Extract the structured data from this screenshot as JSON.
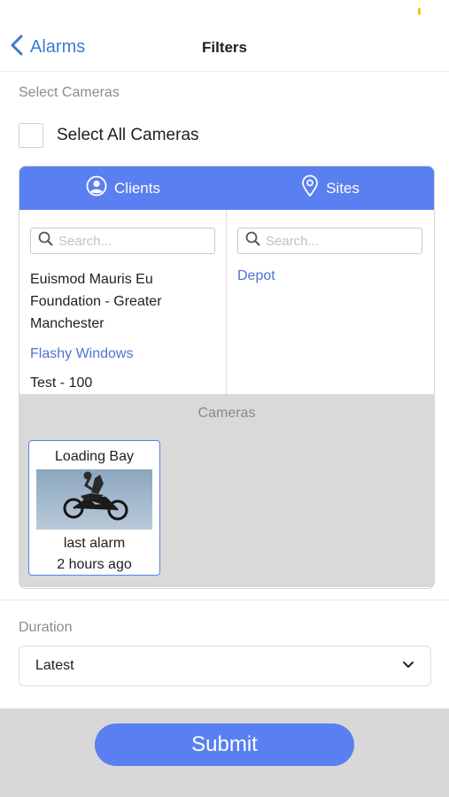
{
  "header": {
    "back_label": "Alarms",
    "title": "Filters"
  },
  "select_cameras": {
    "section_label": "Select Cameras",
    "select_all_label": "Select All Cameras",
    "select_all_checked": false
  },
  "tabs": [
    {
      "label": "Clients",
      "icon": "user-circle-icon"
    },
    {
      "label": "Sites",
      "icon": "location-pin-icon"
    }
  ],
  "clients": {
    "search_placeholder": "Search...",
    "items": [
      {
        "label": "Euismod Mauris Eu Foundation - Greater Manchester",
        "selected": false
      },
      {
        "label": "Flashy Windows",
        "selected": true
      },
      {
        "label": "Test - 100",
        "selected": false
      }
    ]
  },
  "sites": {
    "search_placeholder": "Search...",
    "items": [
      {
        "label": "Depot",
        "selected": true
      }
    ]
  },
  "cameras": {
    "title": "Cameras",
    "items": [
      {
        "name": "Loading Bay",
        "last_alarm_label": "last alarm",
        "last_alarm_time": "2 hours ago",
        "thumbnail": "motocross-jump-thumbnail"
      }
    ]
  },
  "duration": {
    "label": "Duration",
    "value": "Latest",
    "icon": "chevron-down-icon"
  },
  "submit_label": "Submit",
  "colors": {
    "accent": "#5a7ff0",
    "link": "#4f72d6",
    "back": "#3d7ad6",
    "footer_bg": "#d8d8d8",
    "cameras_bg": "#d9d9d9"
  }
}
